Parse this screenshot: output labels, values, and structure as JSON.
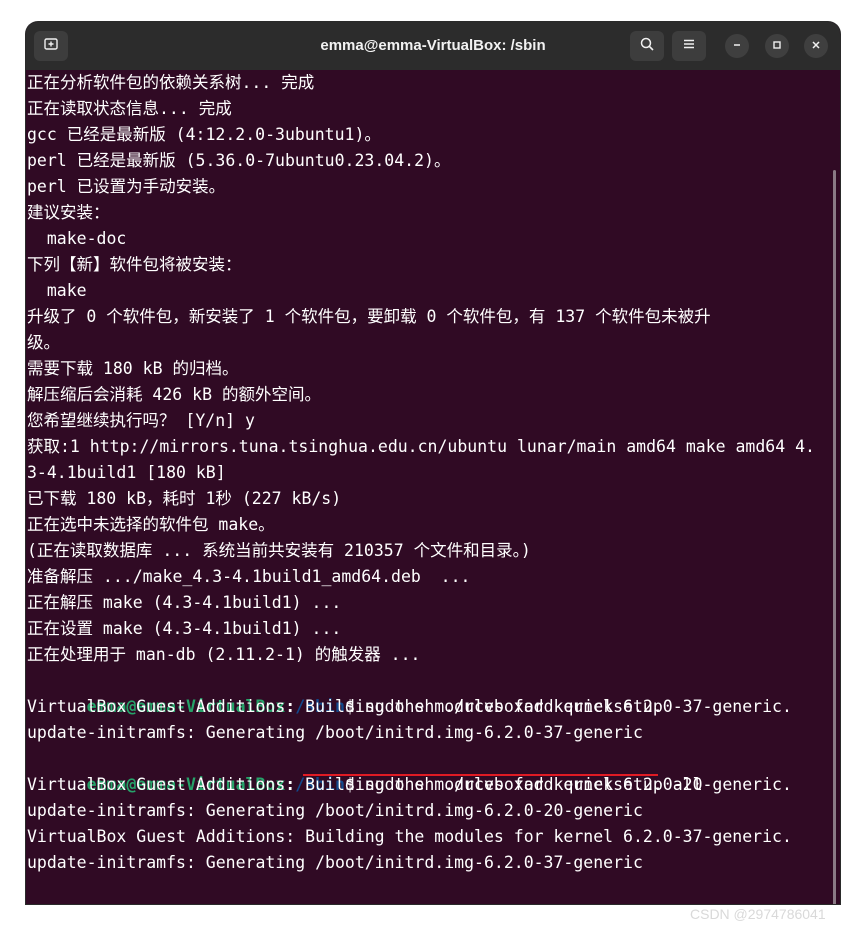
{
  "window": {
    "title": "emma@emma-VirtualBox: /sbin"
  },
  "icons": {
    "new_tab": "new-tab-icon",
    "search": "search-icon",
    "menu": "hamburger-menu-icon",
    "minimize": "minimize-icon",
    "maximize": "maximize-icon",
    "close": "close-icon"
  },
  "colors": {
    "terminal_bg": "#300a24",
    "prompt_user": "#26a269",
    "prompt_path": "#12488b",
    "annotation_underline": "#e01b24"
  },
  "prompt": {
    "user": "emma@emma-VirtualBox",
    "sep": ":",
    "path": "/sbin",
    "dollar": "$"
  },
  "terminal": {
    "output_lines": [
      "正在分析软件包的依赖关系树... 完成",
      "正在读取状态信息... 完成",
      "gcc 已经是最新版 (4:12.2.0-3ubuntu1)。",
      "perl 已经是最新版 (5.36.0-7ubuntu0.23.04.2)。",
      "perl 已设置为手动安装。",
      "建议安装：",
      "  make-doc",
      "下列【新】软件包将被安装：",
      "  make",
      "升级了 0 个软件包，新安装了 1 个软件包，要卸载 0 个软件包，有 137 个软件包未被升",
      "级。",
      "需要下载 180 kB 的归档。",
      "解压缩后会消耗 426 kB 的额外空间。",
      "您希望继续执行吗？ [Y/n] y",
      "获取:1 http://mirrors.tuna.tsinghua.edu.cn/ubuntu lunar/main amd64 make amd64 4.",
      "3-4.1build1 [180 kB]",
      "已下载 180 kB，耗时 1秒 (227 kB/s)",
      "正在选中未选择的软件包 make。",
      "(正在读取数据库 ... 系统当前共安装有 210357 个文件和目录。)",
      "准备解压 .../make_4.3-4.1build1_amd64.deb  ...",
      "正在解压 make (4.3-4.1build1) ...",
      "正在设置 make (4.3-4.1build1) ...",
      "正在处理用于 man-db (2.11.2-1) 的触发器 ..."
    ],
    "command1": " sudo sh ./rcvboxadd quicksetup",
    "output2": [
      "VirtualBox Guest Additions: Building the modules for kernel 6.2.0-37-generic.",
      "update-initramfs: Generating /boot/initrd.img-6.2.0-37-generic"
    ],
    "command2": " sudo sh ./rcvboxadd quicksetup all",
    "output3": [
      "VirtualBox Guest Additions: Building the modules for kernel 6.2.0-20-generic.",
      "update-initramfs: Generating /boot/initrd.img-6.2.0-20-generic",
      "VirtualBox Guest Additions: Building the modules for kernel 6.2.0-37-generic.",
      "update-initramfs: Generating /boot/initrd.img-6.2.0-37-generic"
    ]
  },
  "watermark": "CSDN @2974786041"
}
